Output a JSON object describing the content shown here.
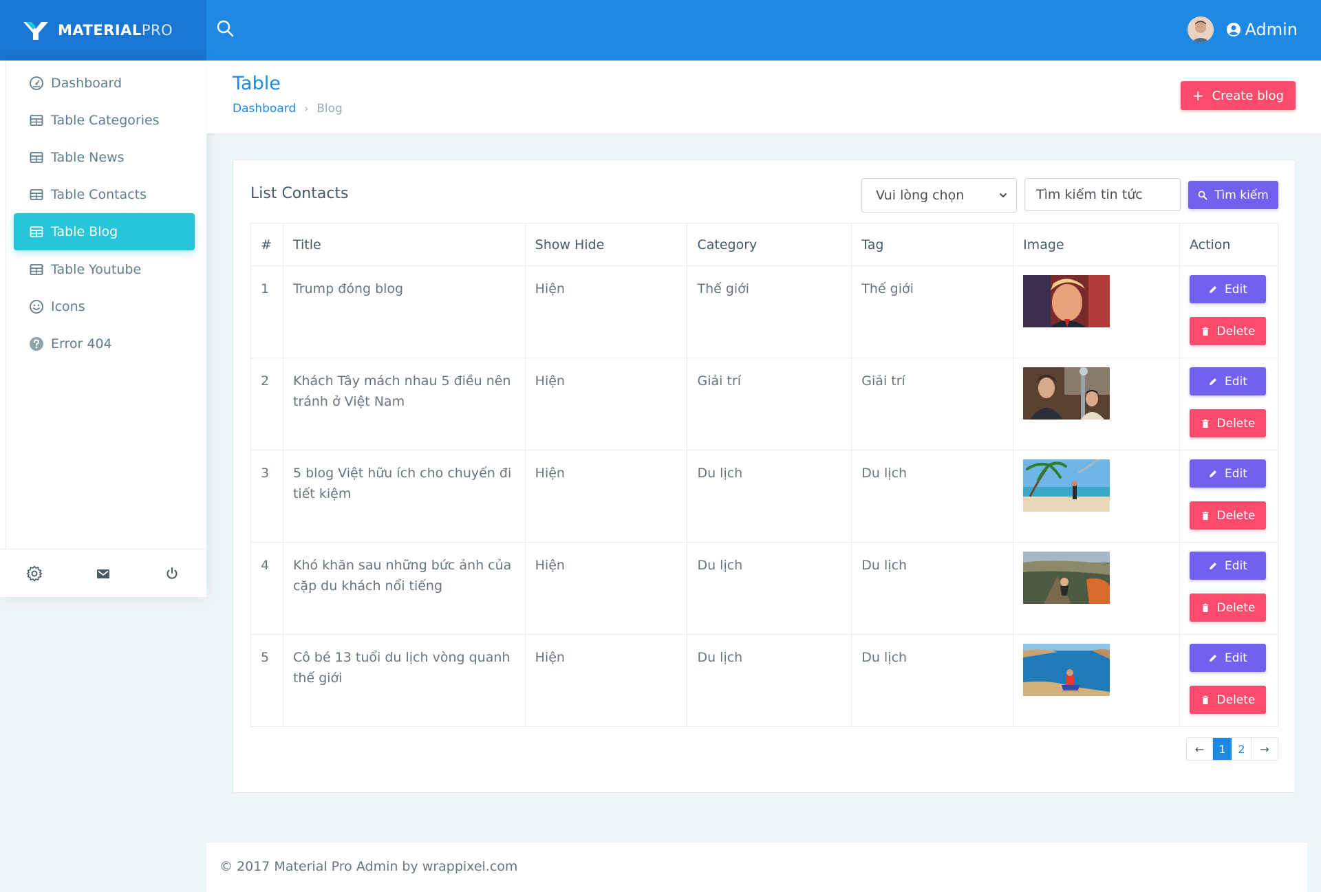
{
  "brand": {
    "bold": "MATERIAL",
    "light": "PRO"
  },
  "header": {
    "user_label": "Admin"
  },
  "sidebar": {
    "items": [
      {
        "label": "Dashboard",
        "icon": "gauge-icon"
      },
      {
        "label": "Table Categories",
        "icon": "table-icon"
      },
      {
        "label": "Table News",
        "icon": "table-icon"
      },
      {
        "label": "Table Contacts",
        "icon": "table-icon"
      },
      {
        "label": "Table Blog",
        "icon": "table-icon",
        "active": true
      },
      {
        "label": "Table Youtube",
        "icon": "table-icon"
      },
      {
        "label": "Icons",
        "icon": "smiley-icon"
      },
      {
        "label": "Error 404",
        "icon": "help-circle-icon"
      }
    ],
    "footer_icons": [
      "settings-icon",
      "mail-icon",
      "power-icon"
    ]
  },
  "page": {
    "title": "Table",
    "breadcrumb": {
      "home": "Dashboard",
      "current": "Blog"
    },
    "create_label": "Create blog"
  },
  "card": {
    "title": "List Contacts",
    "select_value": "Vui lòng chọn",
    "search_placeholder": "Tìm kiếm tin tức",
    "search_label": "Tìm kiếm"
  },
  "table": {
    "headers": [
      "#",
      "Title",
      "Show Hide",
      "Category",
      "Tag",
      "Image",
      "Action"
    ],
    "edit_label": "Edit",
    "delete_label": "Delete",
    "rows": [
      {
        "num": "1",
        "title": "Trump đóng blog",
        "show": "Hiện",
        "category": "Thế giới",
        "tag": "Thế giới",
        "image": "portrait"
      },
      {
        "num": "2",
        "title": "Khách Tây mách nhau 5 điều nên tránh ở Việt Nam",
        "show": "Hiện",
        "category": "Giải trí",
        "tag": "Giải trí",
        "image": "people"
      },
      {
        "num": "3",
        "title": "5 blog Việt hữu ích cho chuyến đi tiết kiệm",
        "show": "Hiện",
        "category": "Du lịch",
        "tag": "Du lịch",
        "image": "beach"
      },
      {
        "num": "4",
        "title": "Khó khăn sau những bức ảnh của cặp du khách nổi tiếng",
        "show": "Hiện",
        "category": "Du lịch",
        "tag": "Du lịch",
        "image": "cliff"
      },
      {
        "num": "5",
        "title": "Cô bé 13 tuổi du lịch vòng quanh thế giới",
        "show": "Hiện",
        "category": "Du lịch",
        "tag": "Du lịch",
        "image": "sea"
      }
    ]
  },
  "pagination": {
    "pages": [
      "1",
      "2"
    ],
    "current": "1",
    "prev": "←",
    "next": "→"
  },
  "footer": {
    "text": "© 2017 Material Pro Admin by wrappixel.com"
  },
  "colors": {
    "topbar": "#1e88e5",
    "brand_bg": "#1976d2",
    "active_item": "#26c6da",
    "primary": "#7460ee",
    "danger": "#fc4b6c"
  }
}
